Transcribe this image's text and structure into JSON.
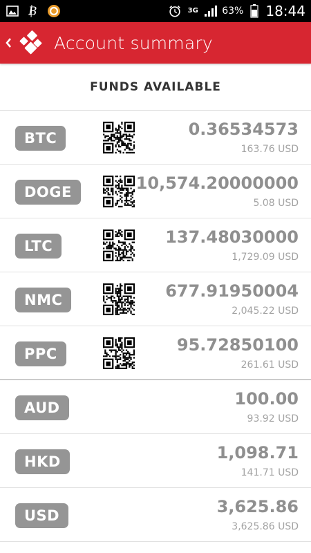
{
  "statusbar": {
    "time": "18:44",
    "battery": "63%",
    "network": "3G",
    "icons": [
      "gallery-icon",
      "bitcoin-icon",
      "app-icon",
      "alarm-icon",
      "network-3g-icon",
      "signal-icon",
      "battery-icon"
    ]
  },
  "appbar": {
    "title": "Account summary",
    "back_icon": "chevron-left-icon",
    "logo_icon": "app-logo-icon",
    "color": "#d72631"
  },
  "funds": {
    "header": "FUNDS AVAILABLE",
    "rows": [
      {
        "code": "BTC",
        "amount": "0.36534573",
        "fiat": "163.76 USD",
        "qr": true
      },
      {
        "code": "DOGE",
        "amount": "10,574.20000000",
        "fiat": "5.08 USD",
        "qr": true
      },
      {
        "code": "LTC",
        "amount": "137.48030000",
        "fiat": "1,729.09 USD",
        "qr": true
      },
      {
        "code": "NMC",
        "amount": "677.91950004",
        "fiat": "2,045.22 USD",
        "qr": true
      },
      {
        "code": "PPC",
        "amount": "95.72850100",
        "fiat": "261.61 USD",
        "qr": true
      },
      {
        "code": "AUD",
        "amount": "100.00",
        "fiat": "93.92 USD",
        "qr": false
      },
      {
        "code": "HKD",
        "amount": "1,098.71",
        "fiat": "141.71 USD",
        "qr": false
      },
      {
        "code": "USD",
        "amount": "3,625.86",
        "fiat": "3,625.86 USD",
        "qr": false
      }
    ]
  },
  "colors": {
    "badge": "#959595",
    "amount": "#8f8f8f",
    "fiat": "#a3a3a3"
  }
}
